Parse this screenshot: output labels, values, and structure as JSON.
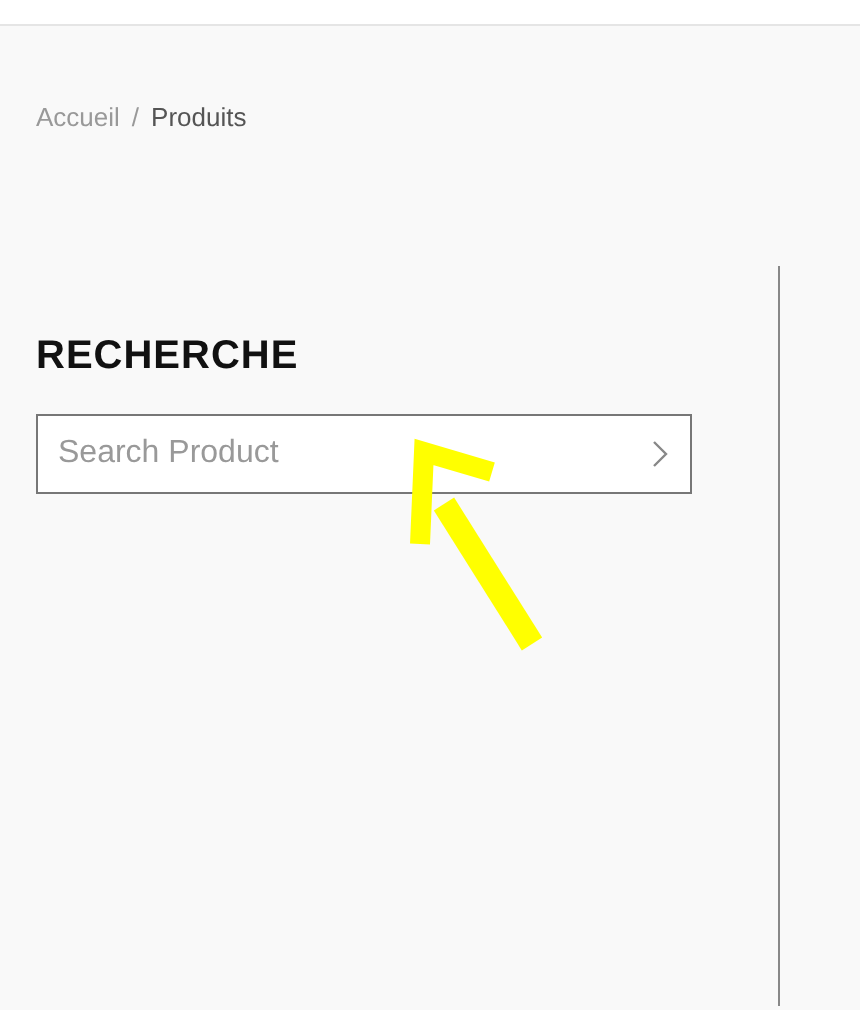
{
  "breadcrumb": [
    {
      "label": "Accueil",
      "current": false
    },
    {
      "label": "Produits",
      "current": true
    }
  ],
  "breadcrumb_separator": "/",
  "sidebar": {
    "title": "RECHERCHE",
    "search": {
      "placeholder": "Search Product"
    }
  },
  "annotation": {
    "kind": "arrow"
  }
}
